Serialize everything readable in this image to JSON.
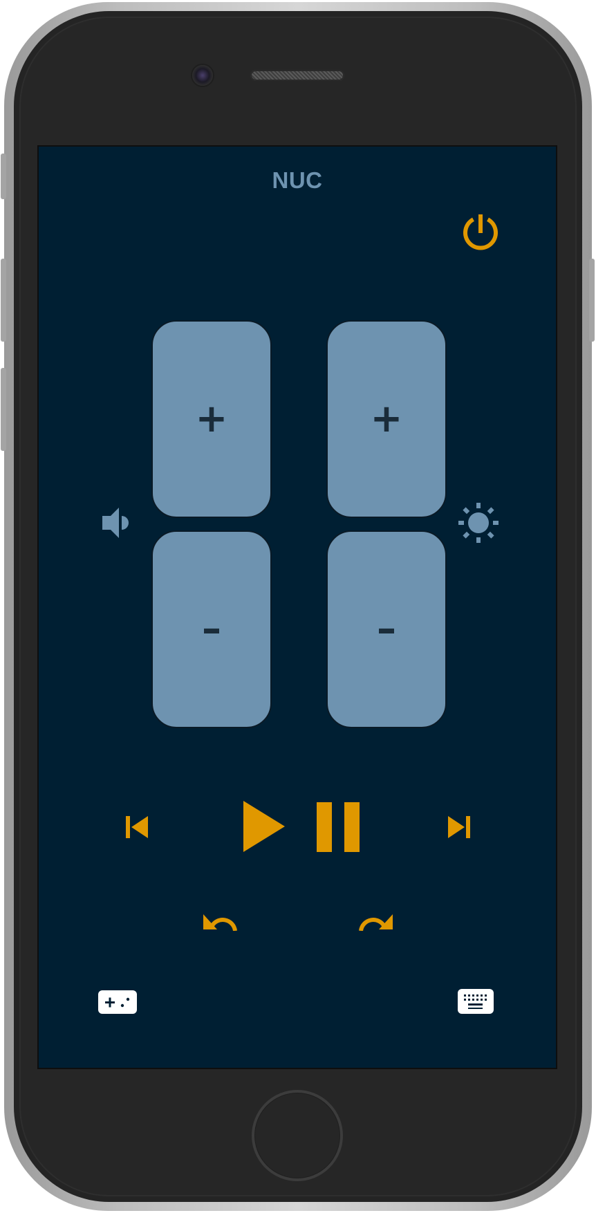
{
  "screen": {
    "title": "NUC"
  },
  "colors": {
    "accent": "#e09800",
    "pad": "#6e93b0",
    "background": "#001f33",
    "pad_text": "#1a2c3a"
  },
  "volume": {
    "icon": "speaker-icon",
    "up_label": "+",
    "down_label": "–"
  },
  "brightness": {
    "icon": "brightness-icon",
    "up_label": "+",
    "down_label": "–"
  },
  "controls": {
    "power_icon": "power-icon",
    "previous_icon": "skip-previous-icon",
    "play_icon": "play-icon",
    "pause_icon": "pause-icon",
    "next_icon": "skip-next-icon",
    "undo_icon": "undo-icon",
    "redo_icon": "redo-icon",
    "gamepad_icon": "gamepad-icon",
    "keyboard_icon": "keyboard-icon"
  }
}
